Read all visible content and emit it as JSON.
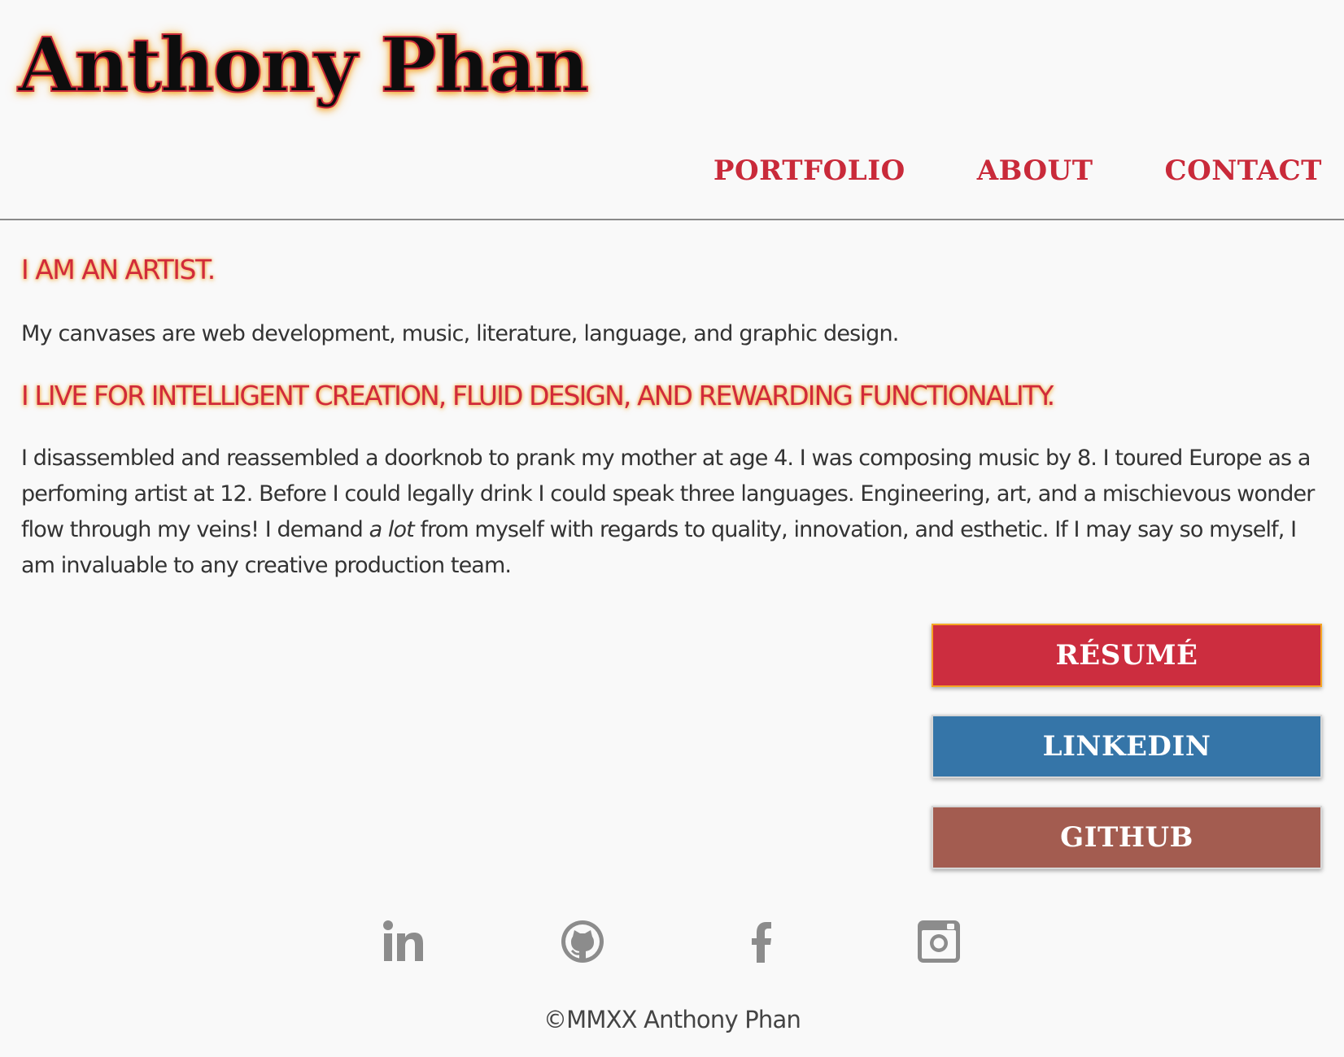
{
  "header": {
    "site_title": "Anthony Phan",
    "nav": {
      "portfolio": "PORTFOLIO",
      "about": "ABOUT",
      "contact": "CONTACT"
    }
  },
  "main": {
    "heading_1": "I AM AN ARTIST.",
    "paragraph_1": "My canvases are web development, music, literature, language, and graphic design.",
    "heading_2": "I LIVE FOR INTELLIGENT CREATION, FLUID DESIGN, AND REWARDING FUNCTIONALITY.",
    "paragraph_2_before": "I disassembled and reassembled a doorknob to prank my mother at age 4. I was composing music by 8. I toured Europe as a perfoming artist at 12. Before I could legally drink I could speak three languages. Engineering, art, and a mischievous wonder flow through my veins! I demand ",
    "paragraph_2_emphasis": "a lot",
    "paragraph_2_after": " from myself with regards to quality, innovation, and esthetic. If I may say so myself, I am invaluable to any creative production team."
  },
  "buttons": {
    "resume": "RÉSUMÉ",
    "linkedin": "LINKEDIN",
    "github": "GITHUB"
  },
  "social": {
    "icons": [
      "linkedin-icon",
      "github-icon",
      "facebook-icon",
      "instagram-icon"
    ],
    "icon_color": "#8c8c8c"
  },
  "footer": {
    "copyright": "©MMXX Anthony Phan"
  },
  "colors": {
    "accent_red": "#c92a3a",
    "glow_orange": "#f5a524",
    "linkedin_blue": "#3575a8",
    "github_brown": "#a35c50",
    "background": "#f9f9f9"
  }
}
